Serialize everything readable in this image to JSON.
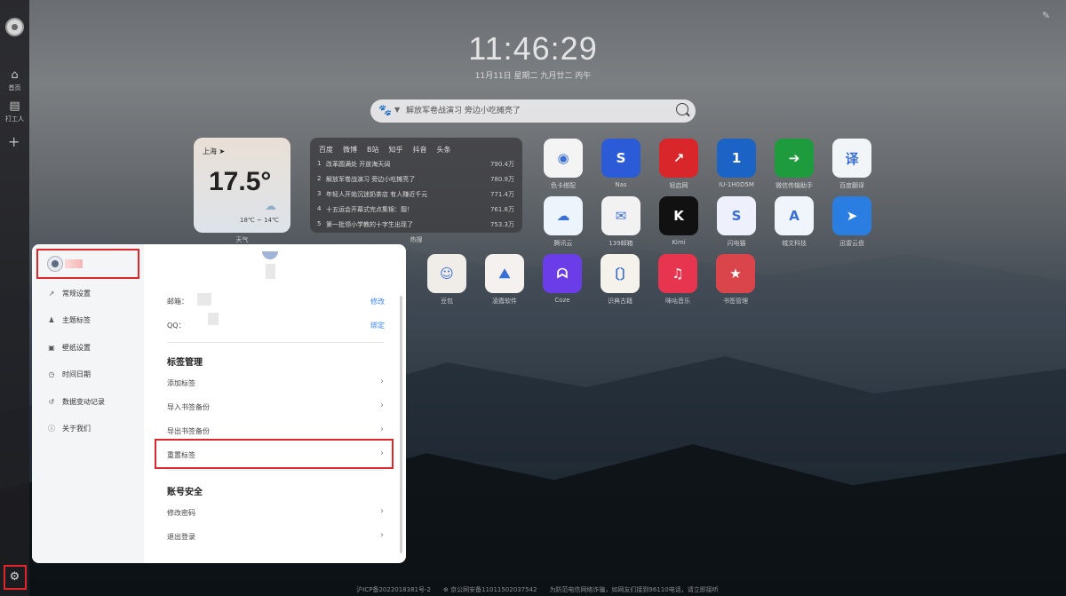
{
  "rail": {
    "items": [
      {
        "label": "首页"
      },
      {
        "label": "打工人"
      }
    ]
  },
  "clock": {
    "time": "11:46:29",
    "date": "11月11日 星期二 九月廿二 丙午"
  },
  "search": {
    "placeholder": "解放军卷战演习 旁边小吃摊亮了"
  },
  "weather": {
    "city": "上海",
    "temp": "17.5°",
    "range": "18℃ ~ 14℃",
    "label": "天气"
  },
  "hot": {
    "tabs": [
      "百度",
      "微博",
      "B站",
      "知乎",
      "抖音",
      "头条"
    ],
    "rows": [
      {
        "n": "1",
        "t": "改革圆满处 开放海天阔",
        "v": "790.4万"
      },
      {
        "n": "2",
        "t": "解放军卷战演习 旁边小吃摊亮了",
        "v": "780.9万"
      },
      {
        "n": "3",
        "t": "年轻人开始沉迷奶茶店 有人赚近千元",
        "v": "771.4万"
      },
      {
        "n": "4",
        "t": "十五运会开幕式完点集锦：靓！",
        "v": "761.8万"
      },
      {
        "n": "5",
        "t": "第一批领小学教的十字生出现了",
        "v": "753.3万"
      }
    ],
    "label": "热搜"
  },
  "apps": [
    {
      "name": "色卡搭配",
      "glyph": "◉",
      "color": "#f4f4f4"
    },
    {
      "name": "Nas",
      "glyph": "S",
      "color": "#2b5bd7"
    },
    {
      "name": "轻启网",
      "glyph": "↗",
      "color": "#d8262a"
    },
    {
      "name": "IU-1H0D5M",
      "glyph": "1",
      "color": "#1b63c4"
    },
    {
      "name": "微信传输助手",
      "glyph": "➔",
      "color": "#1e9b3c"
    },
    {
      "name": "百度翻译",
      "glyph": "译",
      "color": "#f2f5f8"
    },
    {
      "name": "腾讯云",
      "glyph": "☁",
      "color": "#eef4fb"
    },
    {
      "name": "139邮箱",
      "glyph": "✉",
      "color": "#f2f2f2"
    },
    {
      "name": "Kimi",
      "glyph": "K",
      "color": "#111111"
    },
    {
      "name": "闪电猫",
      "glyph": "S",
      "color": "#eef0fb"
    },
    {
      "name": "城文科技",
      "glyph": "A",
      "color": "#f0f4fb"
    },
    {
      "name": "迅雷云盘",
      "glyph": "➤",
      "color": "#2a7de1"
    },
    {
      "name": "豆包",
      "glyph": "☺",
      "color": "#f0ece8"
    },
    {
      "name": "凌霞软件",
      "glyph": "⛰",
      "color": "#f4f1ee"
    },
    {
      "name": "Coze",
      "glyph": "ᗣ",
      "color": "#6a3de8"
    },
    {
      "name": "识典古籍",
      "glyph": "〔〕",
      "color": "#f5f2ec"
    },
    {
      "name": "咪咕音乐",
      "glyph": "♫",
      "color": "#e7344f"
    },
    {
      "name": "书签管理",
      "glyph": "★",
      "color": "#d9454b"
    }
  ],
  "panel": {
    "sidebar": [
      {
        "label": "常规设置",
        "icon": "↗"
      },
      {
        "label": "主题标签",
        "icon": "♟"
      },
      {
        "label": "壁纸设置",
        "icon": "▣"
      },
      {
        "label": "时间日期",
        "icon": "◷"
      },
      {
        "label": "数据变动记录",
        "icon": "↺"
      },
      {
        "label": "关于我们",
        "icon": "ⓘ"
      }
    ],
    "email_label": "邮箱：",
    "email_action": "修改",
    "qq_label": "QQ：",
    "qq_action": "绑定",
    "bookmark_section": "标签管理",
    "bookmark_options": [
      "添加标签",
      "导入书签备份",
      "导出书签备份",
      "重置标签"
    ],
    "account_section": "账号安全",
    "account_options": [
      "修改密码",
      "退出登录"
    ]
  },
  "footer": {
    "icp": "沪ICP备2022018381号-2",
    "police": "京公网安备11011502037542",
    "notice": "为防范电信网络诈骗，如网友们接到96110电话，请立即接听"
  }
}
